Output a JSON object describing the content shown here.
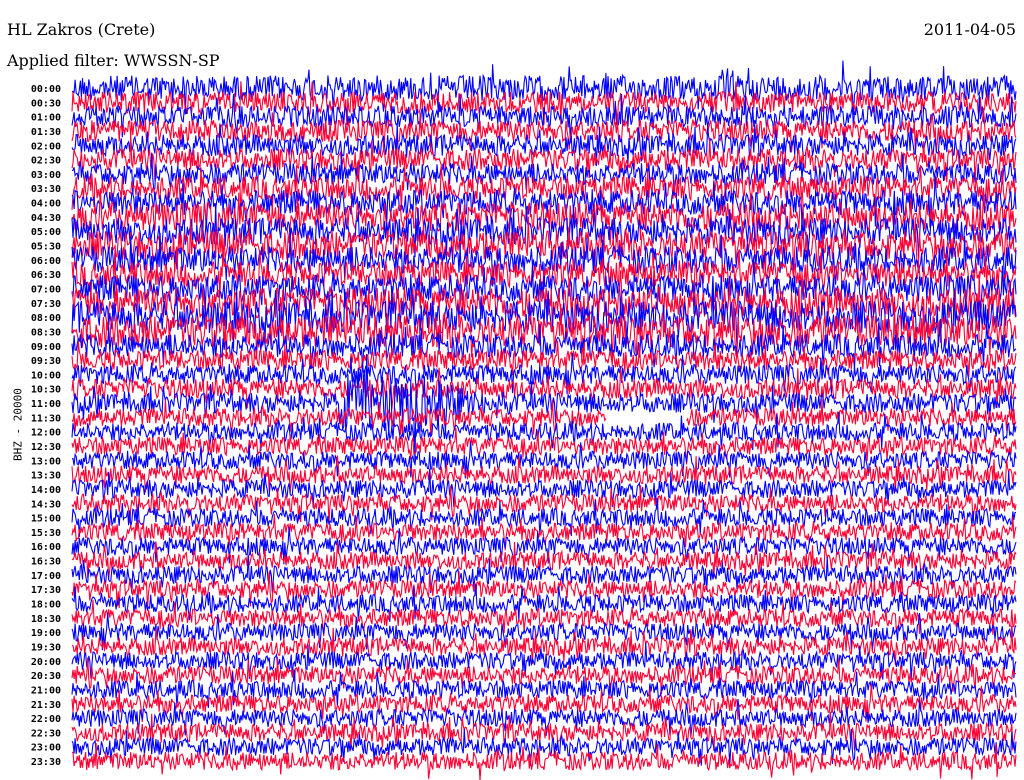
{
  "header": {
    "station": "HL Zakros (Crete)",
    "date": "2011-04-05",
    "filter": "Applied filter: WWSSN-SP"
  },
  "chart_data": {
    "type": "line",
    "title": "HL Zakros (Crete)",
    "subtitle": "Applied filter: WWSSN-SP",
    "ylabel": "BHZ - 20000",
    "xlabel": "",
    "minutes_per_line": 30,
    "colors": [
      "#0000ff",
      "#ff0033"
    ],
    "trace_labels": [
      "00:00",
      "00:30",
      "01:00",
      "01:30",
      "02:00",
      "02:30",
      "03:00",
      "03:30",
      "04:00",
      "04:30",
      "05:00",
      "05:30",
      "06:00",
      "06:30",
      "07:00",
      "07:30",
      "08:00",
      "08:30",
      "09:00",
      "09:30",
      "10:00",
      "10:30",
      "11:00",
      "11:30",
      "12:00",
      "12:30",
      "13:00",
      "13:30",
      "14:00",
      "14:30",
      "15:00",
      "15:30",
      "16:00",
      "16:30",
      "17:00",
      "17:30",
      "18:00",
      "18:30",
      "19:00",
      "19:30",
      "20:00",
      "20:30",
      "21:00",
      "21:30",
      "22:00",
      "22:30",
      "23:00",
      "23:30"
    ],
    "relative_amplitude": [
      1.4,
      1.2,
      1.2,
      1.2,
      1.2,
      1.2,
      1.2,
      1.3,
      1.4,
      1.6,
      1.5,
      1.6,
      1.5,
      1.4,
      1.5,
      1.7,
      1.8,
      1.8,
      1.3,
      1.1,
      1.1,
      1.1,
      1.1,
      1.0,
      1.0,
      1.0,
      1.0,
      1.0,
      1.0,
      1.0,
      1.0,
      1.0,
      1.0,
      1.0,
      1.0,
      1.0,
      1.0,
      1.0,
      1.0,
      1.0,
      1.0,
      1.0,
      1.0,
      1.0,
      1.0,
      1.0,
      1.0,
      1.0
    ],
    "events": [
      {
        "trace": "11:00",
        "minute_start": 9,
        "minute_end": 11,
        "relative_amplitude": 3.0
      }
    ],
    "gaps": [
      {
        "trace": "11:30",
        "minute_start": 17,
        "minute_end": 19.5
      }
    ]
  }
}
